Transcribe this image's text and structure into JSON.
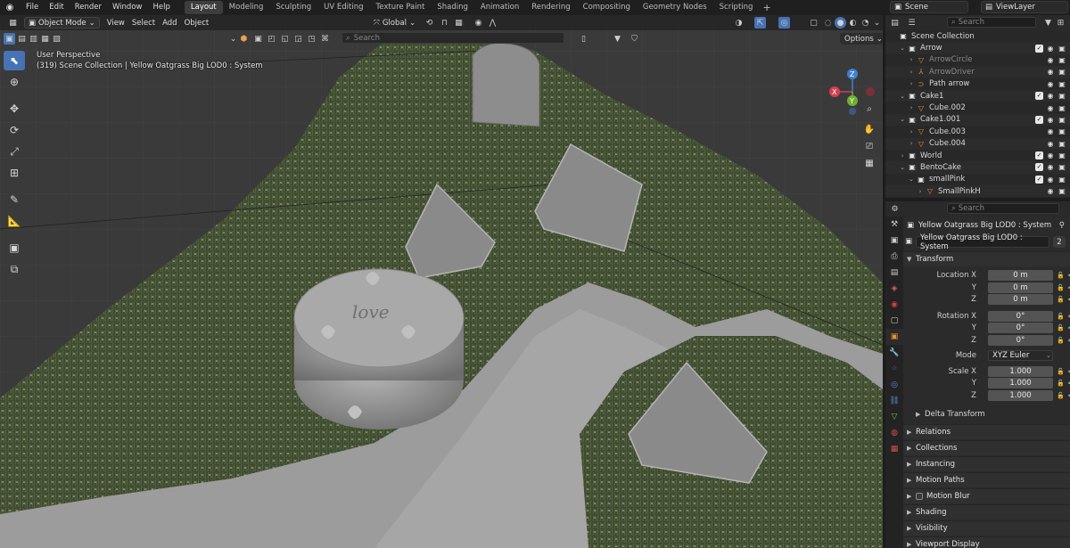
{
  "menu": {
    "items": [
      "File",
      "Edit",
      "Render",
      "Window",
      "Help"
    ]
  },
  "workspaces": {
    "tabs": [
      "Layout",
      "Modeling",
      "Sculpting",
      "UV Editing",
      "Texture Paint",
      "Shading",
      "Animation",
      "Rendering",
      "Compositing",
      "Geometry Nodes",
      "Scripting"
    ],
    "active": "Layout",
    "add": "+"
  },
  "scene": {
    "name": "Scene",
    "view_layer": "ViewLayer"
  },
  "viewport": {
    "mode": "Object Mode",
    "menu": [
      "View",
      "Select",
      "Add",
      "Object"
    ],
    "orientation": "Global",
    "search_placeholder": "Search",
    "options": "Options",
    "perspective": "User Perspective",
    "info": "(319) Scene Collection | Yellow Oatgrass Big LOD0 : System",
    "gizmo": {
      "x": "X",
      "y": "Y",
      "z": "Z"
    },
    "cake_text": "love",
    "colors": {
      "grass": "#3d4a2c",
      "ground": "#9a9a9a",
      "clay": "#8c8c8c",
      "axis_x": "#d04050",
      "axis_y": "#70b030",
      "axis_z": "#4080d0"
    }
  },
  "outliner": {
    "search_placeholder": "Search",
    "rows": [
      {
        "label": "Scene Collection",
        "type": "collection",
        "indent": 0
      },
      {
        "label": "Arrow",
        "type": "collection",
        "indent": 1,
        "open": true
      },
      {
        "label": "ArrowCircle",
        "type": "object",
        "indent": 2,
        "dim": true
      },
      {
        "label": "ArrowDriver",
        "type": "empty",
        "indent": 2,
        "dim": true
      },
      {
        "label": "Path arrow",
        "type": "curve",
        "indent": 2
      },
      {
        "label": "Cake1",
        "type": "collection",
        "indent": 1,
        "open": true
      },
      {
        "label": "Cube.002",
        "type": "mesh",
        "indent": 2
      },
      {
        "label": "Cake1.001",
        "type": "collection",
        "indent": 1,
        "open": true
      },
      {
        "label": "Cube.003",
        "type": "mesh",
        "indent": 2
      },
      {
        "label": "Cube.004",
        "type": "mesh",
        "indent": 2
      },
      {
        "label": "World",
        "type": "collection",
        "indent": 1
      },
      {
        "label": "BentoCake",
        "type": "collection",
        "indent": 1,
        "open": true
      },
      {
        "label": "smallPink",
        "type": "collection",
        "indent": 2,
        "open": true
      },
      {
        "label": "SmallPinkH",
        "type": "mesh",
        "indent": 3
      }
    ]
  },
  "properties": {
    "search_placeholder": "Search",
    "object_title": "Yellow Oatgrass Big LOD0 : System",
    "object_name": "Yellow Oatgrass Big LOD0 : System",
    "users": "2",
    "transform": {
      "title": "Transform",
      "location": {
        "label_x": "Location X",
        "label_y": "Y",
        "label_z": "Z",
        "x": "0 m",
        "y": "0 m",
        "z": "0 m"
      },
      "rotation": {
        "label_x": "Rotation X",
        "label_y": "Y",
        "label_z": "Z",
        "x": "0°",
        "y": "0°",
        "z": "0°"
      },
      "mode": {
        "label": "Mode",
        "value": "XYZ Euler"
      },
      "scale": {
        "label_x": "Scale X",
        "label_y": "Y",
        "label_z": "Z",
        "x": "1.000",
        "y": "1.000",
        "z": "1.000"
      },
      "delta": "Delta Transform"
    },
    "panels": [
      "Relations",
      "Collections",
      "Instancing",
      "Motion Paths",
      "Motion Blur",
      "Shading",
      "Visibility",
      "Viewport Display"
    ]
  }
}
